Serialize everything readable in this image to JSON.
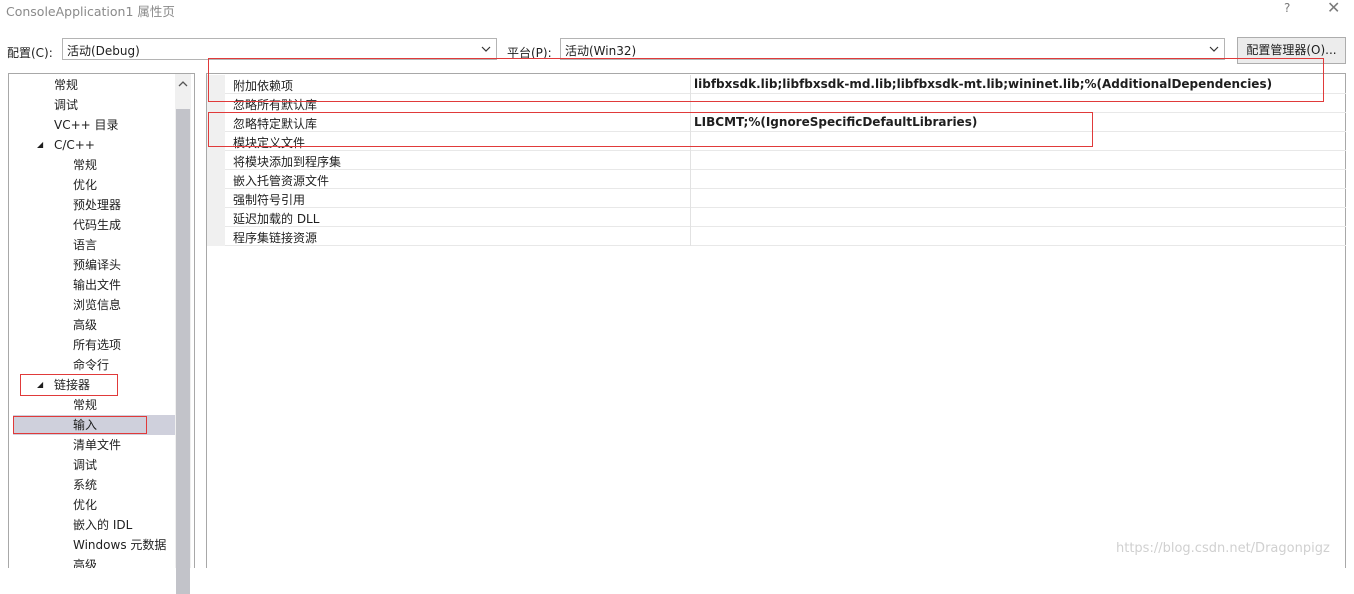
{
  "window": {
    "title": "ConsoleApplication1 属性页",
    "help_label": "?",
    "close_label": "✕"
  },
  "toolbar": {
    "config_label": "配置(C):",
    "config_value": "活动(Debug)",
    "platform_label": "平台(P):",
    "platform_value": "活动(Win32)",
    "manager_button": "配置管理器(O)..."
  },
  "tree": {
    "items": [
      {
        "label": "常规"
      },
      {
        "label": "调试"
      },
      {
        "label": "VC++ 目录"
      },
      {
        "label": "C/C++",
        "expander": "◢"
      },
      {
        "label": "常规"
      },
      {
        "label": "优化"
      },
      {
        "label": "预处理器"
      },
      {
        "label": "代码生成"
      },
      {
        "label": "语言"
      },
      {
        "label": "预编译头"
      },
      {
        "label": "输出文件"
      },
      {
        "label": "浏览信息"
      },
      {
        "label": "高级"
      },
      {
        "label": "所有选项"
      },
      {
        "label": "命令行"
      },
      {
        "label": "链接器",
        "expander": "◢"
      },
      {
        "label": "常规"
      },
      {
        "label": "输入"
      },
      {
        "label": "清单文件"
      },
      {
        "label": "调试"
      },
      {
        "label": "系统"
      },
      {
        "label": "优化"
      },
      {
        "label": "嵌入的 IDL"
      },
      {
        "label": "Windows 元数据"
      },
      {
        "label": "高级"
      }
    ],
    "selected_index": 17
  },
  "properties": [
    {
      "name": "附加依赖项",
      "value": "libfbxsdk.lib;libfbxsdk-md.lib;libfbxsdk-mt.lib;wininet.lib;%(AdditionalDependencies)"
    },
    {
      "name": "忽略所有默认库",
      "value": ""
    },
    {
      "name": "忽略特定默认库",
      "value": "LIBCMT;%(IgnoreSpecificDefaultLibraries)"
    },
    {
      "name": "模块定义文件",
      "value": ""
    },
    {
      "name": "将模块添加到程序集",
      "value": ""
    },
    {
      "name": "嵌入托管资源文件",
      "value": ""
    },
    {
      "name": "强制符号引用",
      "value": ""
    },
    {
      "name": "延迟加载的 DLL",
      "value": ""
    },
    {
      "name": "程序集链接资源",
      "value": ""
    }
  ],
  "watermark": "https://blog.csdn.net/Dragonpigz",
  "colors": {
    "selection": "#cfd0dc",
    "annotation_red": "#e03a3a"
  }
}
